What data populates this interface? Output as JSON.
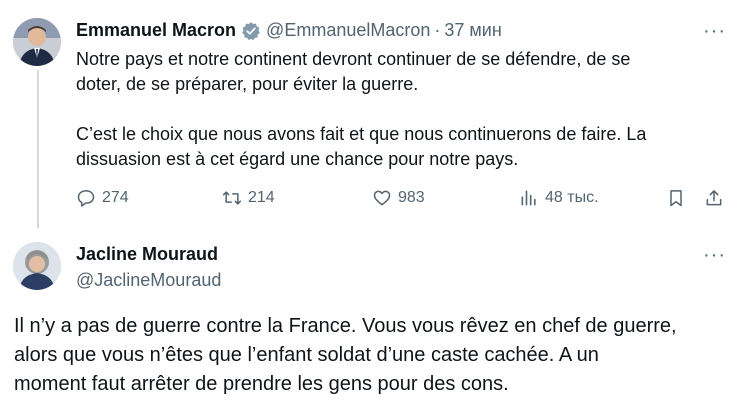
{
  "tweet": {
    "author_name": "Emmanuel Macron",
    "author_handle": "@EmmanuelMacron",
    "separator": "·",
    "time": "37 мин",
    "paragraph1": "Notre pays et notre continent devront continuer de se défendre, de se\ndoter, de se préparer, pour éviter la guerre.",
    "paragraph2": "C’est le choix que nous avons fait et que nous continuerons de faire. La\ndissuasion est à cet égard une chance pour notre pays.",
    "more_icon": "···",
    "actions": {
      "replies": "274",
      "reposts": "214",
      "likes": "983",
      "views": "48 тыс."
    },
    "verified_color": "#829aab"
  },
  "reply": {
    "author_name": "Jacline Mouraud",
    "author_handle": "@JaclineMouraud",
    "more_icon": "···",
    "text": "Il n’y a pas de guerre contre la France. Vous vous rêvez en chef de guerre,\nalors que vous n’êtes que l’enfant soldat d’une caste cachée. A un\nmoment faut arrêter de prendre les gens pour des cons."
  }
}
